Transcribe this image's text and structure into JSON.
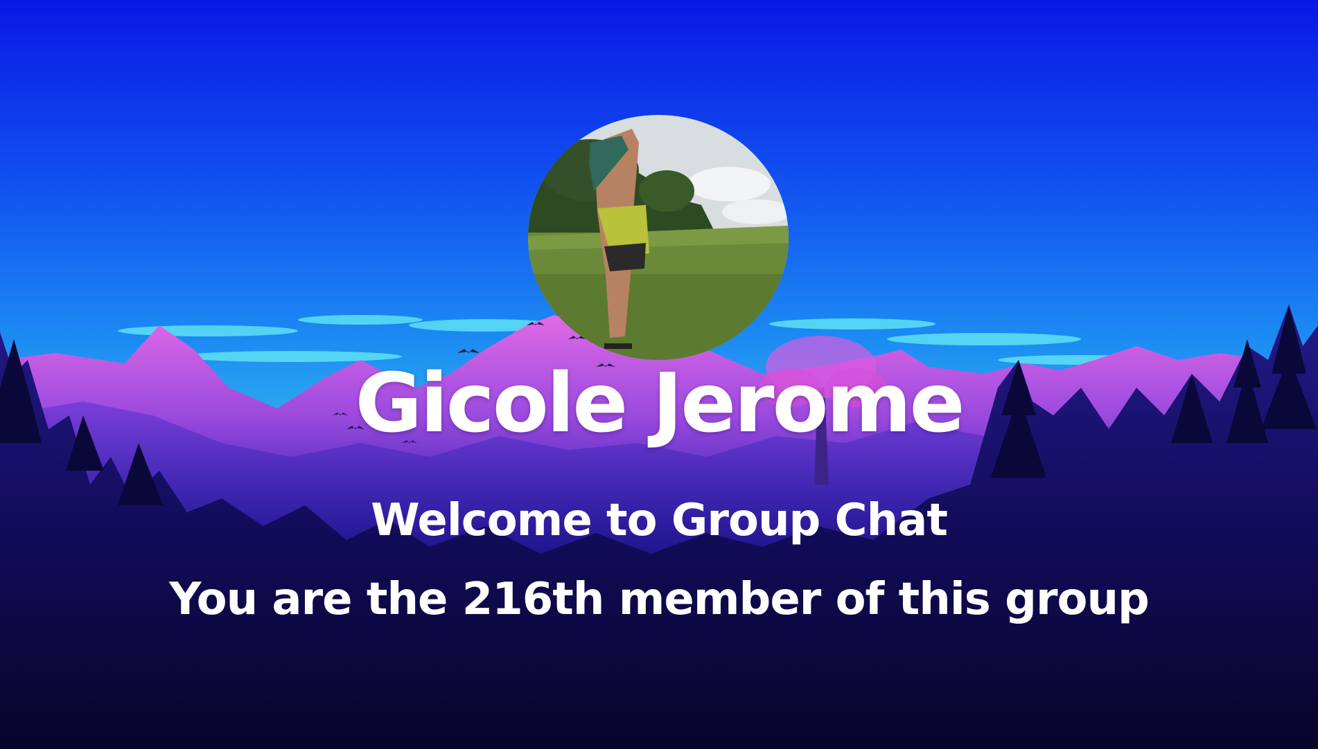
{
  "card": {
    "name": "Gicole Jerome",
    "welcome": "Welcome to Group Chat",
    "member_line": "You are the 216th member of this group"
  },
  "background": {
    "scene": "mountain-forest-landscape",
    "sky_top": "#0a1fe8",
    "sky_mid": "#1f7ef0",
    "peak_pink": "#e85ce8",
    "forest_dark": "#0a0830"
  },
  "avatar": {
    "icon": "profile-photo"
  }
}
